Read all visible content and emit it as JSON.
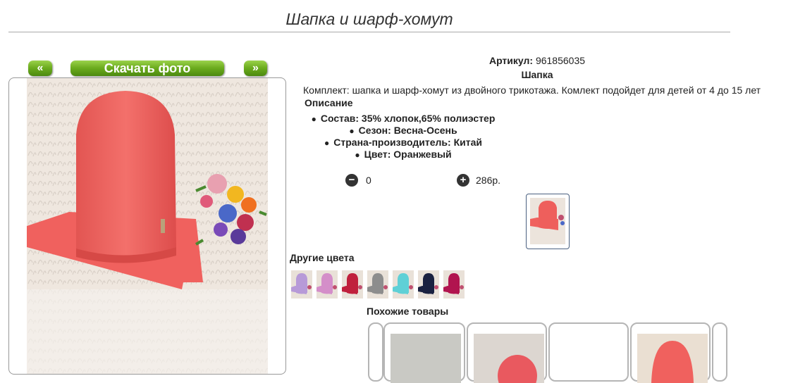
{
  "page": {
    "title": "Шапка и шарф-хомут"
  },
  "nav": {
    "prev_label": "«",
    "download_label": "Скачать фото",
    "next_label": "»"
  },
  "product": {
    "article_label": "Артикул:",
    "article_value": "961856035",
    "type": "Шапка",
    "description": "Комплект: шапка и шарф-хомут из двойного трикотажа. Комлект подойдет для детей от 4 до 15 лет",
    "description_heading": "Описание",
    "properties": [
      "Состав: 35% хлопок,65% полиэстер",
      "Сезон: Весна-Осень",
      "Страна-производитель: Китай",
      "Цвет: Оранжевый"
    ]
  },
  "cart": {
    "quantity": "0",
    "price": "286р."
  },
  "other_colors": {
    "heading": "Другие цвета",
    "colors": [
      "#b79ad8",
      "#d48ec9",
      "#c0203d",
      "#8d8d8d",
      "#5fd0d6",
      "#1a2140",
      "#b1144f"
    ]
  },
  "similar": {
    "heading": "Похожие товары"
  },
  "colors": {
    "accent_green": "#6aaa1d",
    "product_coral": "#f0615e",
    "fur": "#efe7e0"
  }
}
